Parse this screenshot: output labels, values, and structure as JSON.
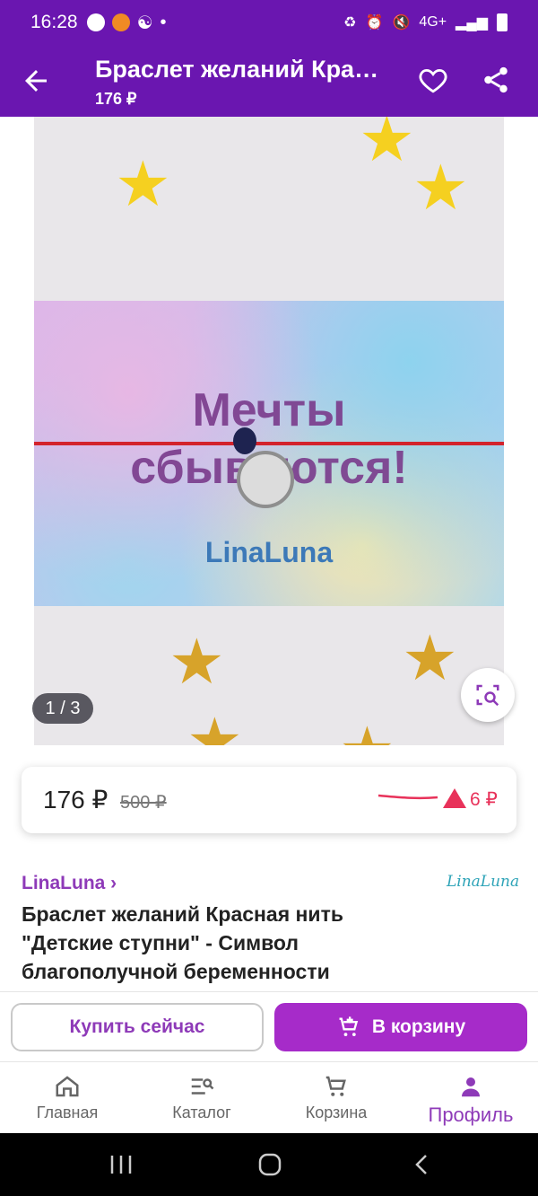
{
  "status": {
    "time": "16:28",
    "network": "4G+"
  },
  "appbar": {
    "title": "Браслет желаний Кра…",
    "subtitle": "176 ₽"
  },
  "gallery": {
    "slogan_line1": "Мечты",
    "slogan_line2": "сбываются!",
    "brand_on_card": "LinaLuna",
    "counter": "1 / 3"
  },
  "price": {
    "current": "176 ₽",
    "old": "500 ₽",
    "change": "6 ₽",
    "accent": "#e8325a"
  },
  "product": {
    "brand": "LinaLuna ›",
    "brand_logo": "LinaLuna",
    "title": "Браслет желаний Красная нить \"Детские ступни\" - Символ благополучной беременности"
  },
  "actions": {
    "buy_now": "Купить сейчас",
    "add_to_cart": "В корзину"
  },
  "nav": {
    "items": [
      {
        "label": "Главная",
        "icon": "home-icon"
      },
      {
        "label": "Каталог",
        "icon": "catalog-icon"
      },
      {
        "label": "Корзина",
        "icon": "cart-icon"
      },
      {
        "label": "Профиль",
        "icon": "profile-icon",
        "active": true
      }
    ]
  },
  "colors": {
    "primary": "#6a16b0",
    "accent_button": "#a62bc9",
    "brand_text": "#8e3ab8"
  }
}
